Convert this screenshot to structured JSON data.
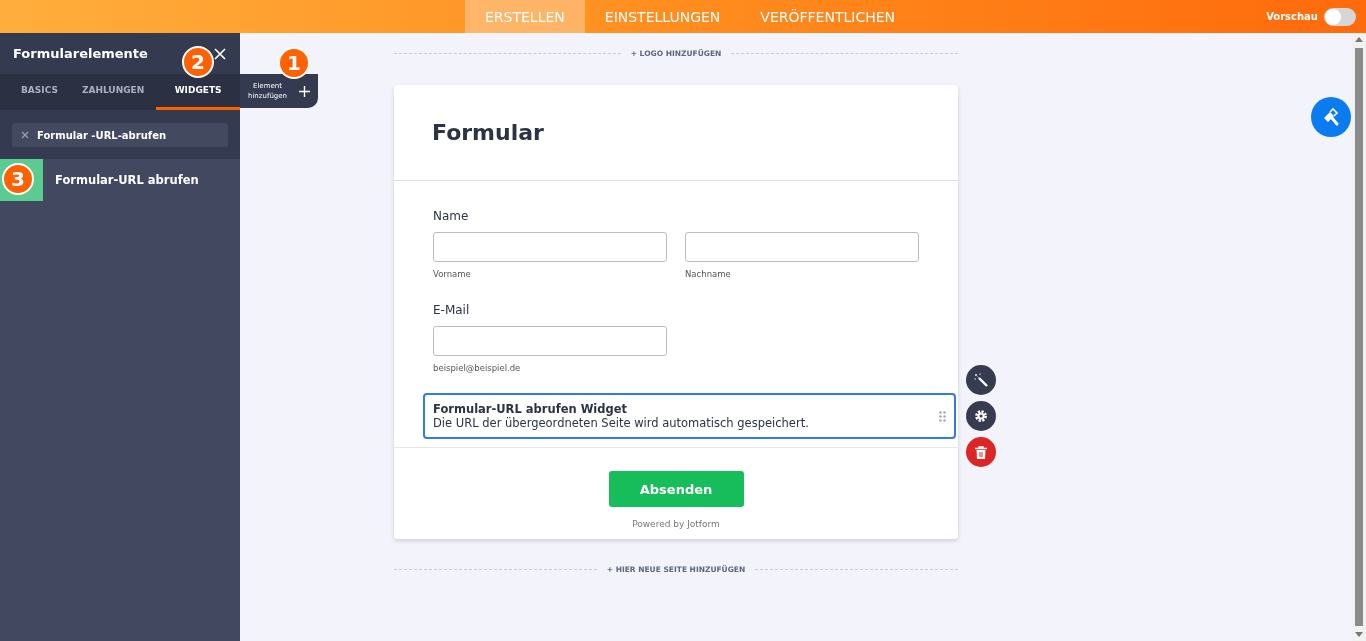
{
  "topbar": {
    "tabs": [
      {
        "label": "ERSTELLEN",
        "selected": true
      },
      {
        "label": "EINSTELLUNGEN",
        "selected": false
      },
      {
        "label": "VERÖFFENTLICHEN",
        "selected": false
      }
    ],
    "preview": {
      "label": "Vorschau",
      "on": false
    }
  },
  "sidebar": {
    "title": "Formularelemente",
    "tabs": [
      {
        "label": "BASICS",
        "selected": false
      },
      {
        "label": "ZAHLUNGEN",
        "selected": false
      },
      {
        "label": "WIDGETS",
        "selected": true
      }
    ],
    "add_element": {
      "label_line_1": "Element",
      "label_line_2": "hinzufügen"
    },
    "search": {
      "value": "Formular -URL-abrufen"
    },
    "items": [
      {
        "label": "Formular-URL abrufen"
      }
    ]
  },
  "callouts": [
    "1",
    "2",
    "3"
  ],
  "canvas": {
    "add_logo": "+ LOGO HINZUFÜGEN",
    "form_title": "Formular",
    "name": {
      "label": "Name",
      "sublabels": [
        "Vorname",
        "Nachname"
      ]
    },
    "email": {
      "label": "E-Mail",
      "sublabel": "beispiel@beispiel.de"
    },
    "widget": {
      "title": "Formular-URL abrufen Widget",
      "description": "Die URL der übergeordneten Seite wird automatisch gespeichert.",
      "selected": true
    },
    "submit": "Absenden",
    "powered_by": "Powered by Jotform",
    "add_page": "+ HIER NEUE SEITE HINZUFÜGEN"
  }
}
